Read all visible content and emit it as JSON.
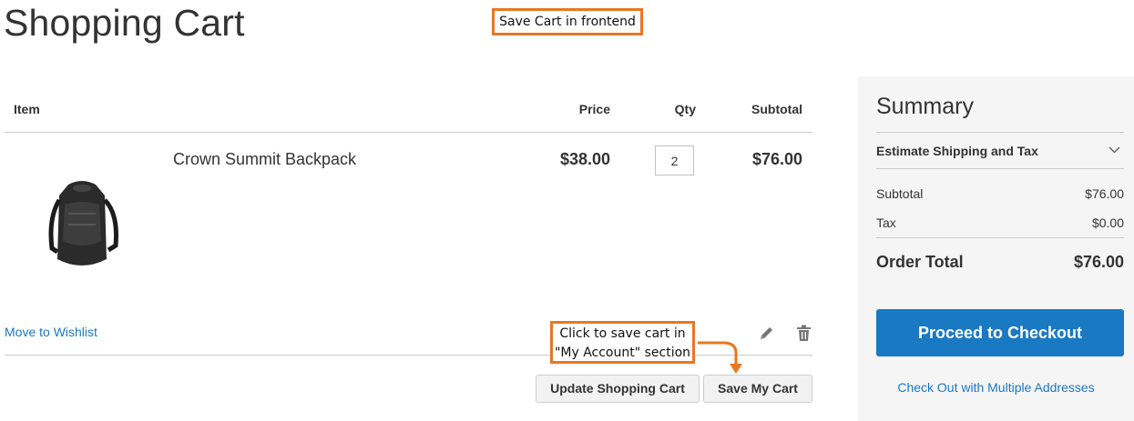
{
  "page": {
    "title": "Shopping Cart"
  },
  "annotations": {
    "top_note": "Save Cart in frontend",
    "mid_note_line1": "Click to save cart in",
    "mid_note_line2": "\"My Account\" section",
    "accent_color": "#e87722"
  },
  "cart": {
    "headers": {
      "item": "Item",
      "price": "Price",
      "qty": "Qty",
      "subtotal": "Subtotal"
    },
    "items": [
      {
        "name": "Crown Summit Backpack",
        "price": "$38.00",
        "qty": "2",
        "subtotal": "$76.00",
        "image_icon": "backpack-image"
      }
    ],
    "move_to_wishlist": "Move to Wishlist",
    "update_button": "Update Shopping Cart",
    "save_button": "Save My Cart"
  },
  "summary": {
    "title": "Summary",
    "estimate": "Estimate Shipping and Tax",
    "subtotal_label": "Subtotal",
    "subtotal_value": "$76.00",
    "tax_label": "Tax",
    "tax_value": "$0.00",
    "order_total_label": "Order Total",
    "order_total_value": "$76.00",
    "checkout_button": "Proceed to Checkout",
    "multi_address_link": "Check Out with Multiple Addresses"
  },
  "colors": {
    "brand_blue": "#1979c3",
    "summary_bg": "#f5f5f5"
  }
}
